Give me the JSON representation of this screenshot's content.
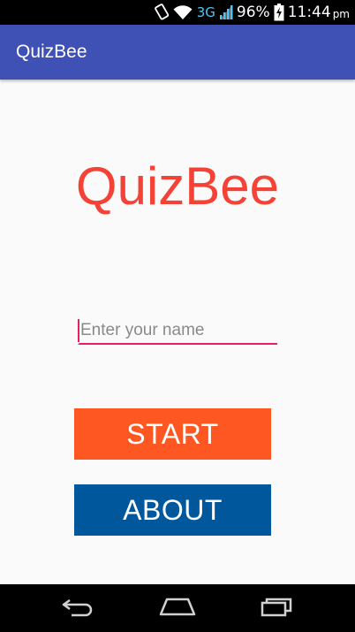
{
  "status_bar": {
    "network": "3G",
    "battery": "96%",
    "time": "11:44",
    "ampm": "pm",
    "icons": [
      "screen-rotation-icon",
      "wifi-icon",
      "cell-signal-icon",
      "battery-charging-icon"
    ]
  },
  "app_bar": {
    "title": "QuizBee",
    "color": "#3f51b5"
  },
  "main": {
    "logo_text": "QuizBee",
    "logo_color": "#f44336",
    "name_input": {
      "value": "",
      "placeholder": "Enter your name"
    },
    "start_button": {
      "label": "START",
      "color": "#ff5722"
    },
    "about_button": {
      "label": "ABOUT",
      "color": "#01579b"
    }
  },
  "nav_bar": {
    "icons": [
      "back-icon",
      "home-icon",
      "recents-icon"
    ]
  }
}
